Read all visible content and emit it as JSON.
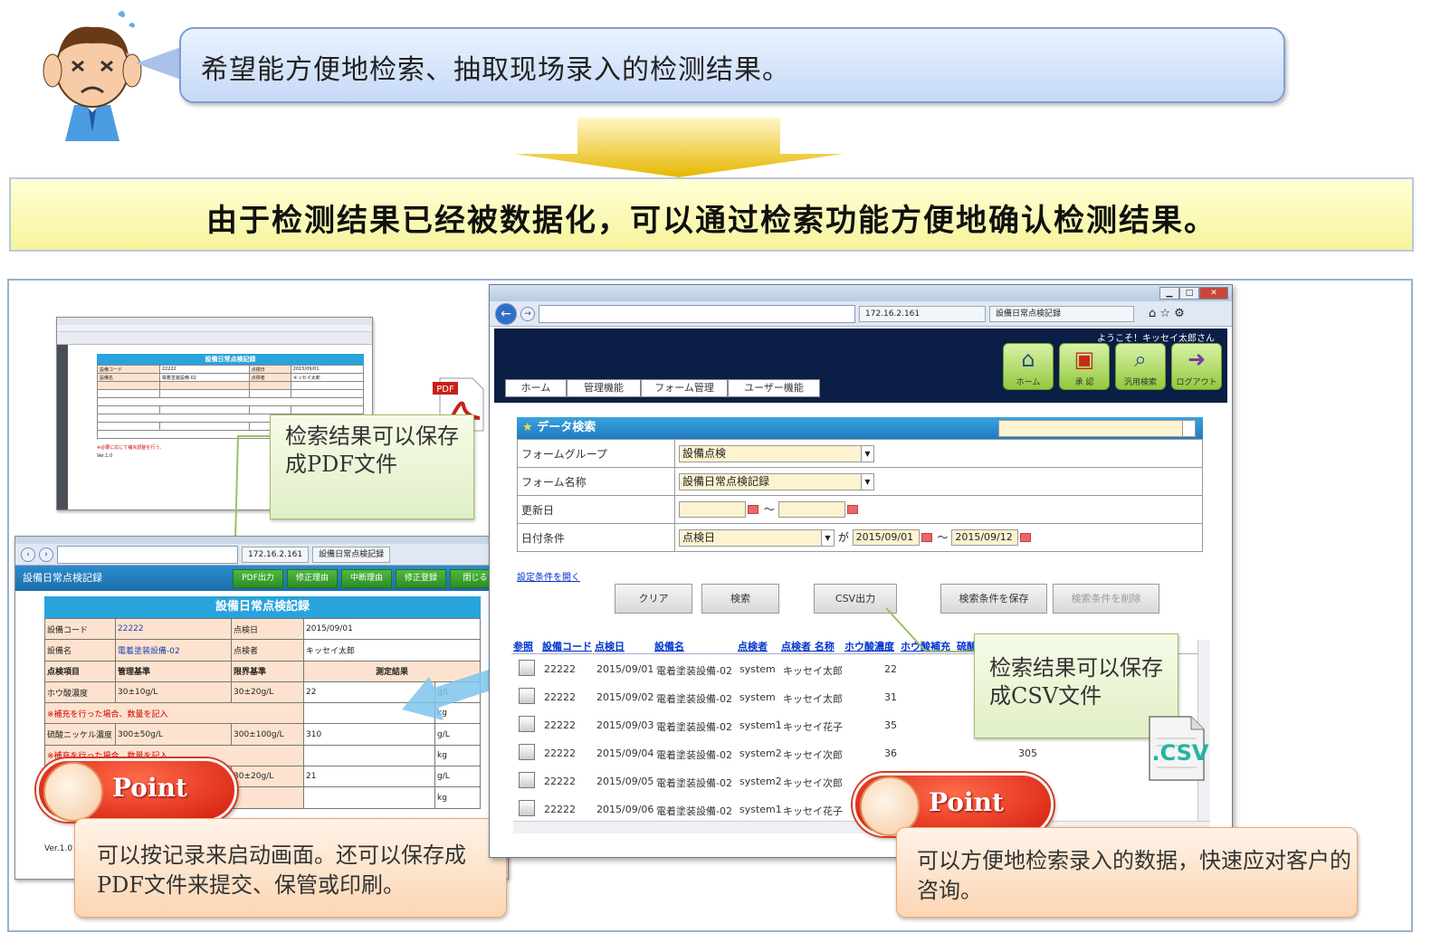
{
  "header": {
    "bubble_text": "希望能方便地检索、抽取现场录入的检测结果。",
    "banner_text": "由于检测结果已经被数据化，可以通过检索功能方便地确认检测结果。"
  },
  "callouts": {
    "pdf_save": "检索结果可以保存成PDF文件",
    "csv_save": "检索结果可以保存成CSV文件",
    "point_label": "Point",
    "point_left": "可以按记录来启动画面。还可以保存成PDF文件来提交、保管或印刷。",
    "point_right": "可以方便地检索录入的数据，快速应对客户的咨询。",
    "csv_icon_label": ".CSV",
    "pdf_icon_label": "PDF"
  },
  "pdf_preview": {
    "title": "設備日常点検記録",
    "version": "Ver.1.0",
    "note": "※必要に応じて補充調整を行う。",
    "rows": [
      [
        "設備コード",
        "22222",
        "点検日",
        "2015/09/01"
      ],
      [
        "設備名",
        "電着塗装設備-02",
        "点検者",
        "キッセイ太郎"
      ]
    ]
  },
  "left_window": {
    "address": "172.16.2.161",
    "tab": "設備日常点検記録",
    "app_title": "設備日常点検記録",
    "buttons": [
      "PDF出力",
      "修正理由",
      "中断理由",
      "修正登録",
      "閉じる"
    ],
    "form_title": "設備日常点検記録",
    "labels": {
      "equip_code": "設備コード",
      "equip_code_val": "22222",
      "date": "点検日",
      "date_val": "2015/09/01",
      "equip_name": "設備名",
      "equip_name_val": "電着塗装設備-02",
      "inspector": "点検者",
      "inspector_val": "キッセイ太郎",
      "item": "点検項目",
      "mgmt": "管理基準",
      "limit": "限界基準",
      "result": "測定結果"
    },
    "rows": [
      {
        "item": "ホウ酸濃度",
        "mgmt": "30±10g/L",
        "limit": "30±20g/L",
        "result": "22",
        "unit": "g/L"
      },
      {
        "note": "※補充を行った場合、数量を記入",
        "unit": "kg"
      },
      {
        "item": "硫酸ニッケル濃度",
        "mgmt": "300±50g/L",
        "limit": "300±100g/L",
        "result": "310",
        "unit": "g/L"
      },
      {
        "note": "※補充を行った場合、数量を記入",
        "unit": "kg"
      },
      {
        "item": "",
        "mgmt": "",
        "limit": "30±20g/L",
        "result": "21",
        "unit": "g/L"
      },
      {
        "note": "",
        "unit": "kg"
      }
    ],
    "version": "Ver.1.0"
  },
  "main_window": {
    "address_ip": "172.16.2.161",
    "tab": "設備日常点検記録",
    "welcome": "ようこそ！キッセイ太郎さん",
    "nav": [
      "ホーム",
      "管理機能",
      "フォーム管理",
      "ユーザー機能"
    ],
    "icons": [
      {
        "label": "ホーム",
        "icon": "house-icon"
      },
      {
        "label": "承 認",
        "icon": "approve-icon"
      },
      {
        "label": "汎用検索",
        "icon": "magnifier-icon"
      },
      {
        "label": "ログアウト",
        "icon": "logout-icon"
      }
    ],
    "search_title": "データ検索",
    "fields": {
      "form_group_label": "フォームグループ",
      "form_group_val": "設備点検",
      "form_name_label": "フォーム名称",
      "form_name_val": "設備日常点検記録",
      "updated_label": "更新日",
      "tilde": "～",
      "date_cond_label": "日付条件",
      "date_cond_val": "点検日",
      "ga": "が",
      "date_from": "2015/09/01",
      "date_to": "2015/09/12"
    },
    "open_settings_link": "設定条件を開く",
    "buttons": [
      "クリア",
      "検索",
      "CSV出力",
      "検索条件を保存",
      "検索条件を削除"
    ],
    "columns": [
      "参照",
      "設備コード",
      "点検日",
      "設備名",
      "点検者",
      "点検者 名称",
      "ホウ酸濃度",
      "ホウ酸補充",
      "硫酸"
    ],
    "rows": [
      {
        "code": "22222",
        "date": "2015/09/01",
        "name": "電着塗装設備-02",
        "user": "system",
        "person": "キッセイ太郎",
        "val": "22",
        "val2": ""
      },
      {
        "code": "22222",
        "date": "2015/09/02",
        "name": "電着塗装設備-02",
        "user": "system",
        "person": "キッセイ太郎",
        "val": "31",
        "val2": ""
      },
      {
        "code": "22222",
        "date": "2015/09/03",
        "name": "電着塗装設備-02",
        "user": "system1",
        "person": "キッセイ花子",
        "val": "35",
        "val2": ""
      },
      {
        "code": "22222",
        "date": "2015/09/04",
        "name": "電着塗装設備-02",
        "user": "system2",
        "person": "キッセイ次郎",
        "val": "36",
        "val2": "305"
      },
      {
        "code": "22222",
        "date": "2015/09/05",
        "name": "電着塗装設備-02",
        "user": "system2",
        "person": "キッセイ次郎",
        "val": "",
        "val2": ""
      },
      {
        "code": "22222",
        "date": "2015/09/06",
        "name": "電着塗装設備-02",
        "user": "system1",
        "person": "キッセイ花子",
        "val": "",
        "val2": ""
      }
    ]
  }
}
